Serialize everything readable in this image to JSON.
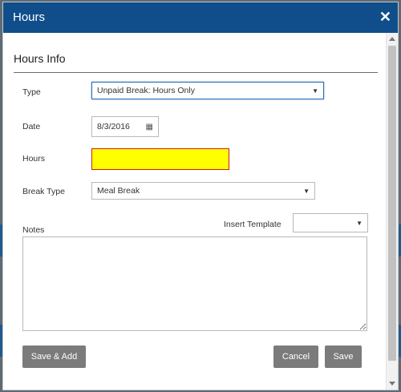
{
  "dialog": {
    "title": "Hours",
    "close_glyph": "✕"
  },
  "section": {
    "title": "Hours Info"
  },
  "form": {
    "type_label": "Type",
    "type_value": "Unpaid Break: Hours Only",
    "date_label": "Date",
    "date_value": "8/3/2016",
    "date_icon": "calendar-icon",
    "hours_label": "Hours",
    "hours_value": "",
    "break_type_label": "Break Type",
    "break_type_value": "Meal Break",
    "notes_label": "Notes",
    "insert_template_label": "Insert Template",
    "insert_template_value": "",
    "notes_value": ""
  },
  "buttons": {
    "save_add": "Save & Add",
    "cancel": "Cancel",
    "save": "Save"
  },
  "colors": {
    "header": "#0f4e8a",
    "error_fill": "#ffff00",
    "error_border": "#d21c1c",
    "button": "#7b7b7b"
  }
}
